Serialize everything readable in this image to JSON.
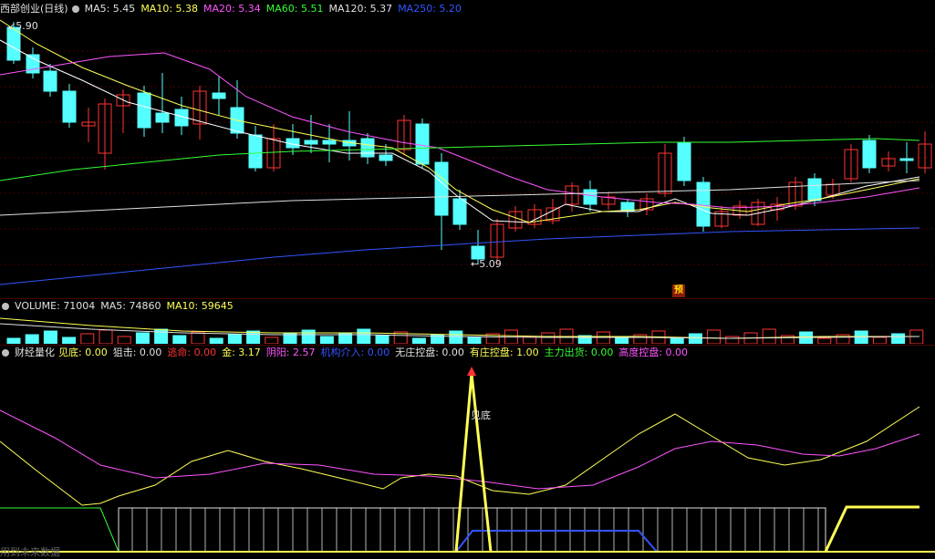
{
  "main": {
    "title": "西部创业(日线)",
    "ma": [
      {
        "label": "MA5: 5.45",
        "color": "#e0e0e0"
      },
      {
        "label": "MA10: 5.38",
        "color": "#ffff55"
      },
      {
        "label": "MA20: 5.34",
        "color": "#ff55ff"
      },
      {
        "label": "MA60: 5.51",
        "color": "#33ff33"
      },
      {
        "label": "MA120: 5.37",
        "color": "#e0e0e0"
      },
      {
        "label": "MA250: 5.20",
        "color": "#3355ff"
      }
    ],
    "high_label": "5.90",
    "low_label": "5.09",
    "badge": "预"
  },
  "volume": {
    "items": [
      {
        "label": "VOLUME: 71004",
        "color": "#e0e0e0"
      },
      {
        "label": "MA5: 74860",
        "color": "#e0e0e0"
      },
      {
        "label": "MA10: 59645",
        "color": "#ffff55"
      }
    ]
  },
  "indicator": {
    "title": "财经量化",
    "items": [
      {
        "label": "见底: 0.00",
        "color": "#ffff55"
      },
      {
        "label": "狙击: 0.00",
        "color": "#e0e0e0"
      },
      {
        "label": "逃命: 0.00",
        "color": "#ff3333"
      },
      {
        "label": "金: 3.17",
        "color": "#ffff55"
      },
      {
        "label": "阴阳: 2.57",
        "color": "#ff55ff"
      },
      {
        "label": "机构介入: 0.00",
        "color": "#3355ff"
      },
      {
        "label": "无庄控盘: 0.00",
        "color": "#e0e0e0"
      },
      {
        "label": "有庄控盘: 1.00",
        "color": "#ffff55"
      },
      {
        "label": "主力出货: 0.00",
        "color": "#33ff33"
      },
      {
        "label": "高度控盘: 0.00",
        "color": "#ff55ff"
      }
    ],
    "signal_label": "见底",
    "footer": "用到未来数据"
  },
  "colors": {
    "up": "#ff3333",
    "down": "#55ffff",
    "bg": "#000000",
    "grid": "#4a0000"
  }
}
